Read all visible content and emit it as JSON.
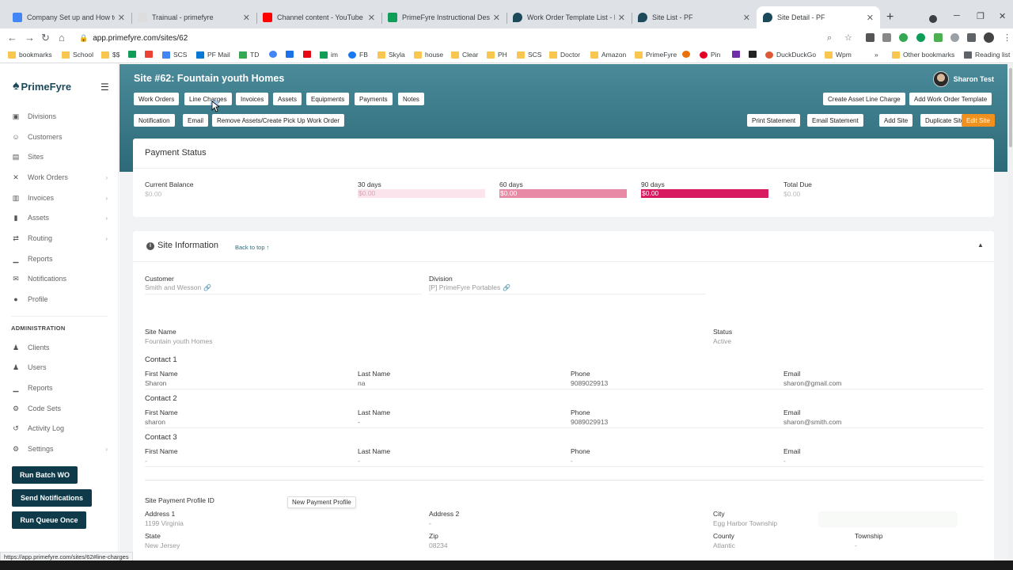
{
  "browser": {
    "tabs": [
      {
        "title": "Company Set up and How to gu",
        "color": "#4285f4"
      },
      {
        "title": "Trainual - primefyre",
        "color": "#444444"
      },
      {
        "title": "Channel content - YouTube Stu",
        "color": "#ff0000"
      },
      {
        "title": "PrimeFyre Instructional Design",
        "color": "#0f9d58"
      },
      {
        "title": "Work Order Template List - PF",
        "color": "#1c4a5a"
      },
      {
        "title": "Site List - PF",
        "color": "#1c4a5a"
      },
      {
        "title": "Site Detail - PF",
        "color": "#1c4a5a"
      }
    ],
    "url": "app.primefyre.com/sites/62",
    "bookmarks": [
      "bookmarks",
      "School",
      "$$",
      "",
      "SCS",
      "PF Mail",
      "TD",
      "",
      "",
      "",
      "im",
      "FB",
      "Skyla",
      "house",
      "Clear",
      "PH",
      "SCS",
      "Doctor",
      "Amazon",
      "PrimeFyre",
      "",
      "Pin",
      "",
      "",
      "DuckDuckGo",
      "Wpm"
    ],
    "bookmarks_more": "»",
    "other_bookmarks": "Other bookmarks",
    "reading_list": "Reading list",
    "status_url": "https://app.primefyre.com/sites/62#line-charges"
  },
  "app": {
    "name": "PrimeFyre",
    "nav": [
      {
        "label": "Divisions",
        "icon": "▣",
        "chev": false
      },
      {
        "label": "Customers",
        "icon": "☺",
        "chev": false
      },
      {
        "label": "Sites",
        "icon": "▤",
        "chev": false
      },
      {
        "label": "Work Orders",
        "icon": "✕",
        "chev": true
      },
      {
        "label": "Invoices",
        "icon": "▥",
        "chev": true
      },
      {
        "label": "Assets",
        "icon": "▮",
        "chev": true
      },
      {
        "label": "Routing",
        "icon": "⇄",
        "chev": true
      },
      {
        "label": "Reports",
        "icon": "▁",
        "chev": false
      },
      {
        "label": "Notifications",
        "icon": "✉",
        "chev": false
      },
      {
        "label": "Profile",
        "icon": "●",
        "chev": false
      }
    ],
    "admin_heading": "ADMINISTRATION",
    "admin_nav": [
      {
        "label": "Clients",
        "icon": "♟",
        "chev": false
      },
      {
        "label": "Users",
        "icon": "♟",
        "chev": false
      },
      {
        "label": "Reports",
        "icon": "▁",
        "chev": false
      },
      {
        "label": "Code Sets",
        "icon": "⚙",
        "chev": false
      },
      {
        "label": "Activity Log",
        "icon": "↺",
        "chev": false
      },
      {
        "label": "Settings",
        "icon": "⚙",
        "chev": true
      }
    ],
    "sidebar_buttons": [
      "Run Batch WO",
      "Send Notifications",
      "Run Queue Once"
    ]
  },
  "header": {
    "title": "Site #62: Fountain youth Homes",
    "user": "Sharon Test",
    "row1_left": [
      "Work Orders",
      "Line Charges",
      "Invoices",
      "Assets",
      "Equipments",
      "Payments",
      "Notes"
    ],
    "row1_right": [
      "Create Asset Line Charge",
      "Add Work Order Template"
    ],
    "row2_left": [
      "Notification",
      "Email",
      "Remove Assets/Create Pick Up Work Order"
    ],
    "row2_right": [
      "Print Statement",
      "Email Statement",
      "Add Site",
      "Duplicate Site"
    ],
    "edit_site": "Edit Site"
  },
  "payment_status": {
    "title": "Payment Status",
    "current_balance": {
      "label": "Current Balance",
      "value": "$0.00"
    },
    "d30": {
      "label": "30 days",
      "value": "$0.00",
      "color": "#fce4ec"
    },
    "d60": {
      "label": "60 days",
      "value": "$0.00",
      "color": "#e88aa6"
    },
    "d90": {
      "label": "90 days",
      "value": "$0.00",
      "color": "#d81b60"
    },
    "total_due": {
      "label": "Total Due",
      "value": "$0.00"
    }
  },
  "site_info": {
    "title": "Site Information",
    "back_to_top": "Back to top",
    "customer": {
      "label": "Customer",
      "value": "Smith and Wesson"
    },
    "division": {
      "label": "Division",
      "value": "[P] PrimeFyre Portables"
    },
    "site_name": {
      "label": "Site Name",
      "value": "Fountain youth Homes"
    },
    "status": {
      "label": "Status",
      "value": "Active"
    },
    "field_labels": {
      "first": "First Name",
      "last": "Last Name",
      "phone": "Phone",
      "email": "Email"
    },
    "contacts": [
      {
        "heading": "Contact 1",
        "first": "Sharon",
        "last": "na",
        "phone": "9089029913",
        "email": "sharon@gmail.com"
      },
      {
        "heading": "Contact 2",
        "first": "sharon",
        "last": "-",
        "phone": "9089029913",
        "email": "sharon@smith.com"
      },
      {
        "heading": "Contact 3",
        "first": "-",
        "last": "-",
        "phone": "-",
        "email": "-"
      }
    ],
    "payment_profile_label": "Site Payment Profile ID",
    "new_payment_profile": "New Payment Profile",
    "address1": {
      "label": "Address 1",
      "value": "1199 Virginia"
    },
    "address2": {
      "label": "Address 2",
      "value": "-"
    },
    "city": {
      "label": "City",
      "value": "Egg Harbor Township"
    },
    "state": {
      "label": "State",
      "value": "New Jersey"
    },
    "zip": {
      "label": "Zip",
      "value": "08234"
    },
    "county": {
      "label": "County",
      "value": "Atlantic"
    },
    "township": {
      "label": "Township",
      "value": "-"
    }
  }
}
